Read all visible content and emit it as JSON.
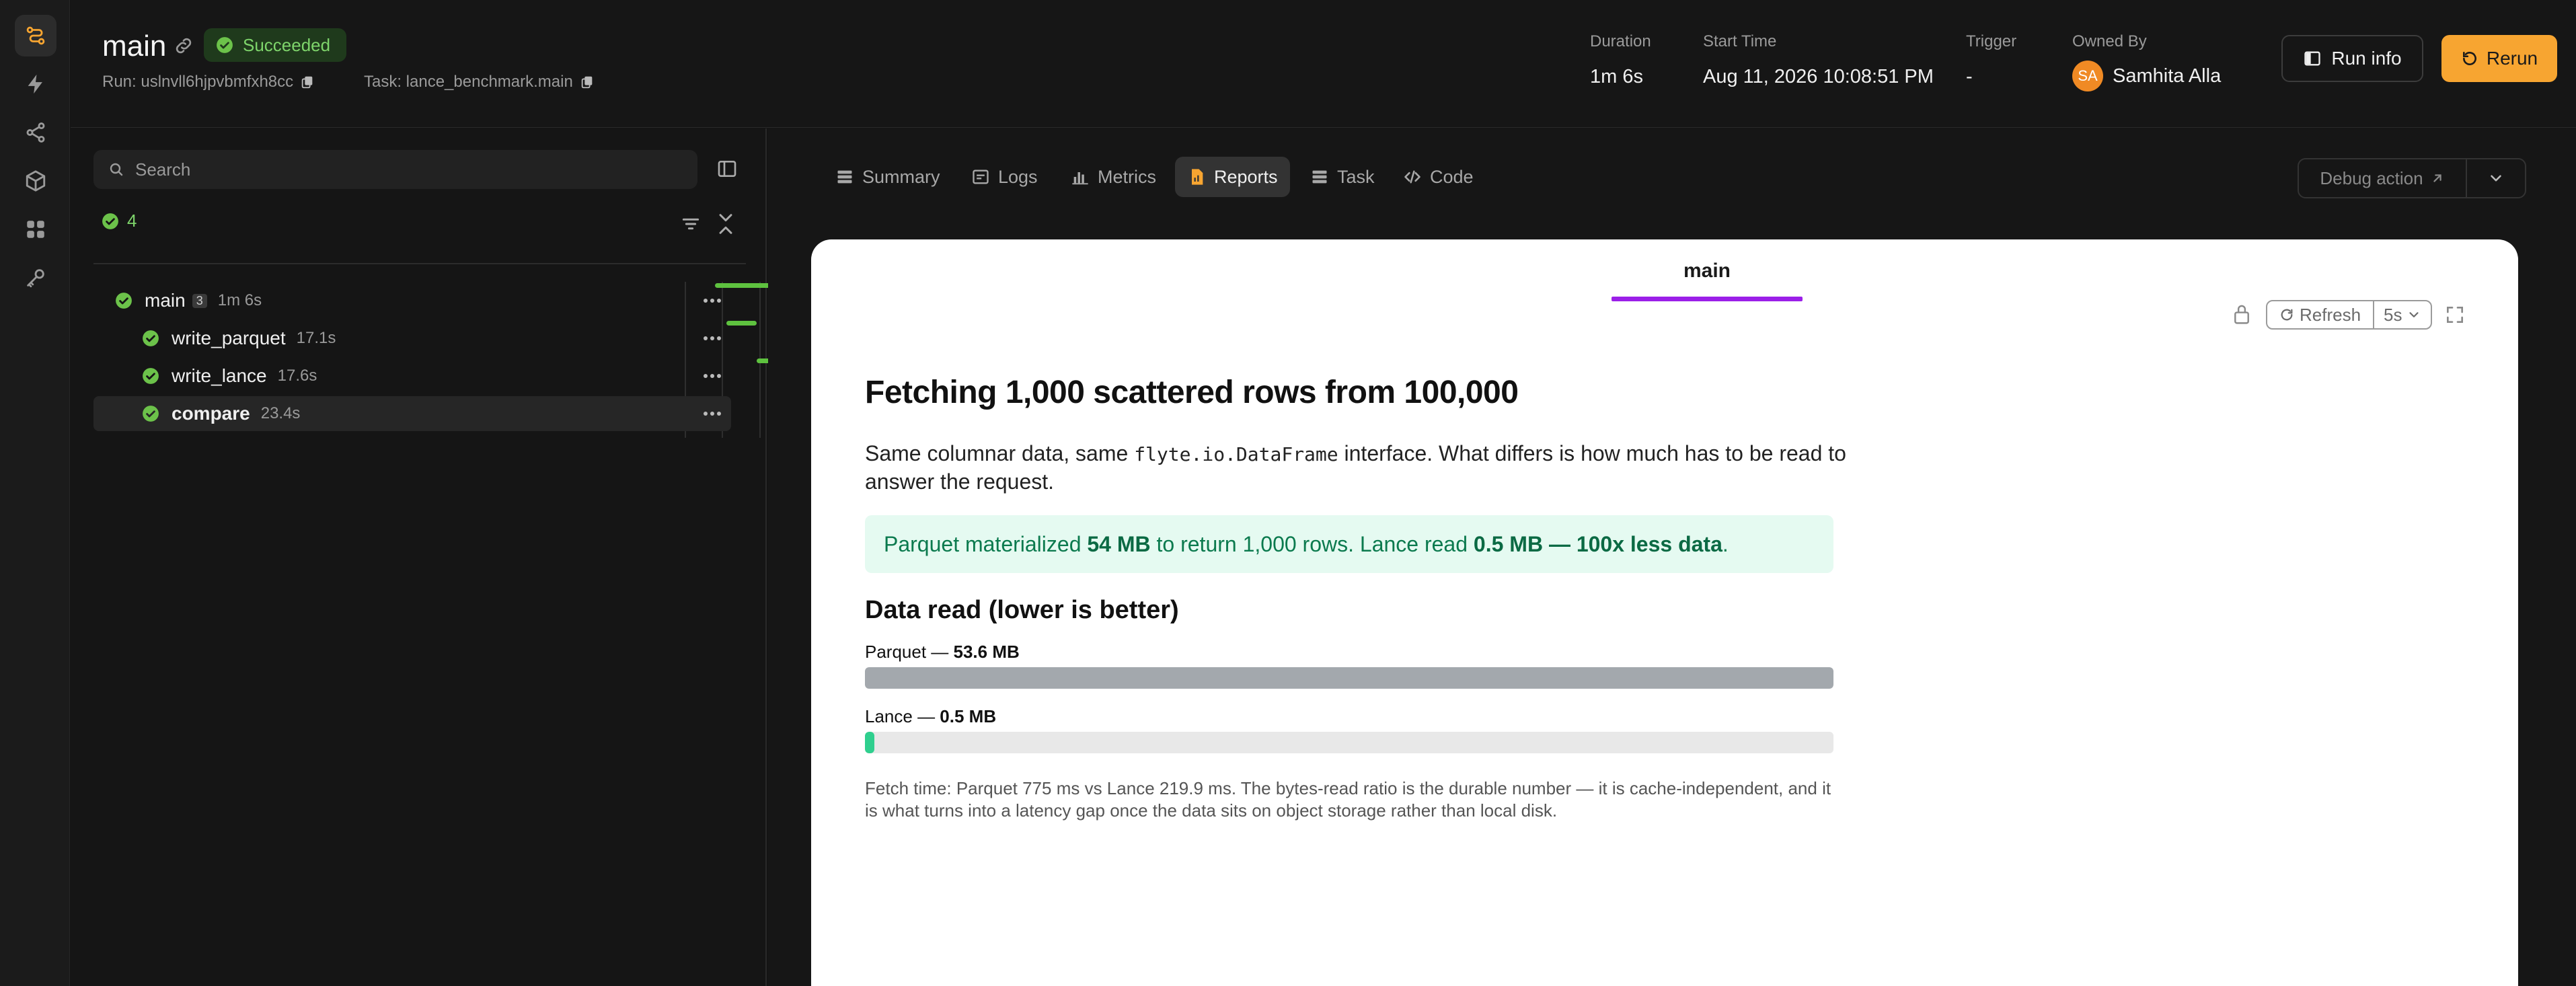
{
  "header": {
    "run_name": "main",
    "status": "Succeeded",
    "run_id_label": "Run: uslnvll6hjpvbmfxh8cc",
    "task_label": "Task: lance_benchmark.main",
    "stats": {
      "duration_label": "Duration",
      "duration": "1m 6s",
      "start_label": "Start Time",
      "start": "Aug 11, 2026 10:08:51 PM",
      "trigger_label": "Trigger",
      "trigger": "-",
      "owner_label": "Owned By",
      "owner": "Samhita Alla",
      "owner_initials": "SA"
    },
    "run_info_label": "Run info",
    "rerun_label": "Rerun"
  },
  "sidebar": {
    "search_placeholder": "Search",
    "succeeded_count": "4",
    "nodes": [
      {
        "name": "main",
        "count": "3",
        "duration": "1m 6s",
        "bar_start": 0.0,
        "bar_end": 1.0
      },
      {
        "name": "write_parquet",
        "duration": "17.1s",
        "bar_start": 0.1,
        "bar_end": 0.36
      },
      {
        "name": "write_lance",
        "duration": "17.6s",
        "bar_start": 0.36,
        "bar_end": 0.62
      },
      {
        "name": "compare",
        "duration": "23.4s",
        "bar_start": 0.64,
        "bar_end": 1.0
      }
    ]
  },
  "tabs": {
    "summary": "Summary",
    "logs": "Logs",
    "metrics": "Metrics",
    "reports": "Reports",
    "task": "Task",
    "code": "Code",
    "debug_action": "Debug action"
  },
  "report": {
    "tab_name": "main",
    "refresh_label": "Refresh",
    "interval": "5s",
    "heading": "Fetching 1,000 scattered rows from 100,000",
    "intro_pre": "Same columnar data, same ",
    "intro_code": "flyte.io.DataFrame",
    "intro_post": " interface. What differs is how much has to be read to answer the request.",
    "callout_1": "Parquet materialized ",
    "callout_2": "54 MB",
    "callout_3": " to return 1,000 rows. Lance read ",
    "callout_4": "0.5 MB — 100x less data",
    "callout_5": ".",
    "subheading": "Data read (lower is better)",
    "bars": [
      {
        "label": "Parquet — ",
        "value_label": "53.6 MB",
        "fraction": 1.0,
        "color": "#a3a8ad"
      },
      {
        "label": "Lance — ",
        "value_label": "0.5 MB",
        "fraction": 0.0093,
        "color": "#2fcf8e"
      }
    ],
    "footnote": "Fetch time: Parquet 775 ms vs Lance 219.9 ms. The bytes-read ratio is the durable number — it is cache-independent, and it is what turns into a latency gap once the data sits on object storage rather than local disk."
  },
  "colors": {
    "accent_orange": "#f7a531",
    "success_green": "#5ec23f",
    "report_underline": "#9b1fe8"
  }
}
